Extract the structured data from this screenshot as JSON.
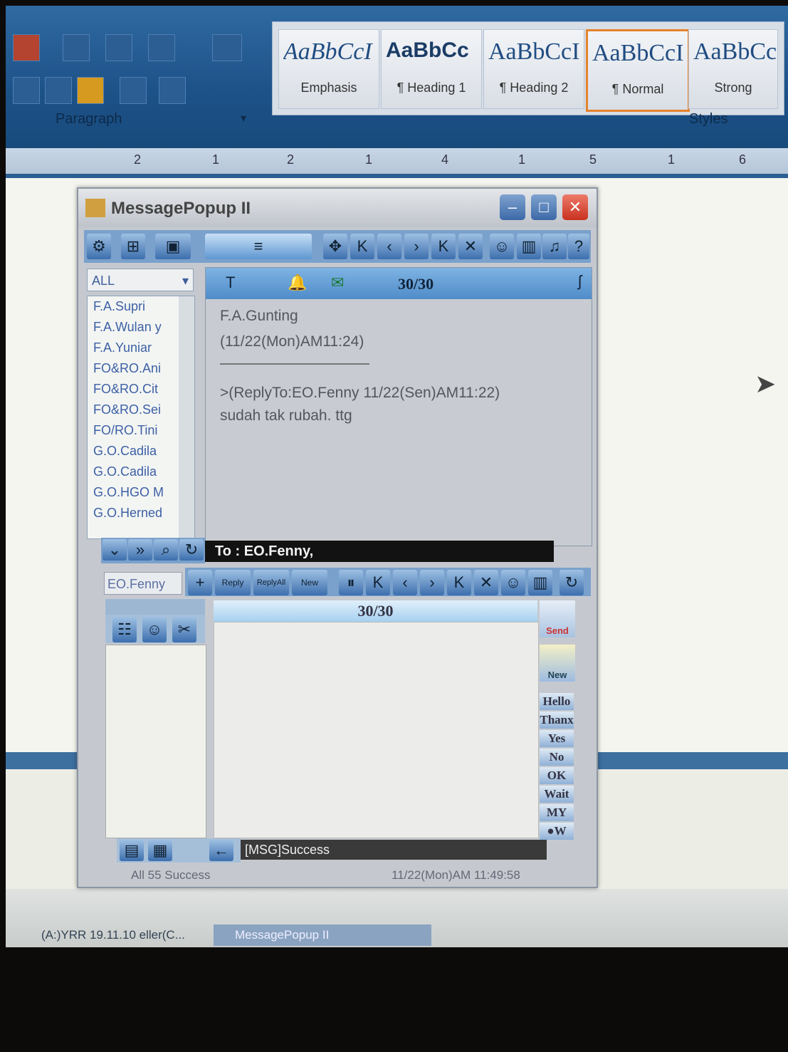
{
  "ribbon": {
    "styles": [
      {
        "sample": "AaBbCcI",
        "name": "Emphasis"
      },
      {
        "sample": "AaBbCc",
        "name": "¶ Heading 1"
      },
      {
        "sample": "AaBbCcI",
        "name": "¶ Heading 2"
      },
      {
        "sample": "AaBbCcI",
        "name": "¶ Normal"
      },
      {
        "sample": "AaBbCc",
        "name": "Strong"
      }
    ],
    "group_paragraph": "Paragraph",
    "group_styles": "Styles",
    "selected_style_index": 3
  },
  "ruler": {
    "marks": [
      "2",
      "1",
      "2",
      "1",
      "4",
      "1",
      "5",
      "1",
      "6"
    ]
  },
  "window": {
    "title": "MessagePopup II",
    "list_filter": "ALL",
    "contacts": [
      "F.A.Supri",
      "F.A.Wulan y",
      "F.A.Yuniar",
      "FO&RO.Ani",
      "FO&RO.Cit",
      "FO&RO.Sei",
      "FO/RO.Tini",
      "G.O.Cadila",
      "G.O.Cadila",
      "G.O.HGO M",
      "G.O.Herned"
    ],
    "message": {
      "counter": "30/30",
      "sender": "F.A.Gunting",
      "time": "(11/22(Mon)AM11:24)",
      "reply_line": ">(ReplyTo:EO.Fenny 11/22(Sen)AM11:22)",
      "body": "sudah tak rubah. ttg"
    },
    "to_line": "To : EO.Fenny,",
    "compose": {
      "recipient": "EO.Fenny",
      "counter": "30/30",
      "reply_label": "Reply",
      "reply_all_label": "ReplyAll",
      "new_label": "New",
      "send_label": "Send",
      "new_msg_label": "New",
      "quick_replies": [
        "Hello",
        "Thanx",
        "Yes",
        "No",
        "OK",
        "Wait",
        "MY",
        "●W"
      ]
    },
    "status_message": "[MSG]Success",
    "footer_status": "All 55 Success",
    "footer_time": "11/22(Mon)AM 11:49:58"
  },
  "taskbar": {
    "items": [
      "(A:)YRR 19.11.10 eller(C...",
      "MessagePopup II"
    ]
  },
  "colors": {
    "title_close": "#c8321e",
    "accent": "#4f8cc9"
  }
}
